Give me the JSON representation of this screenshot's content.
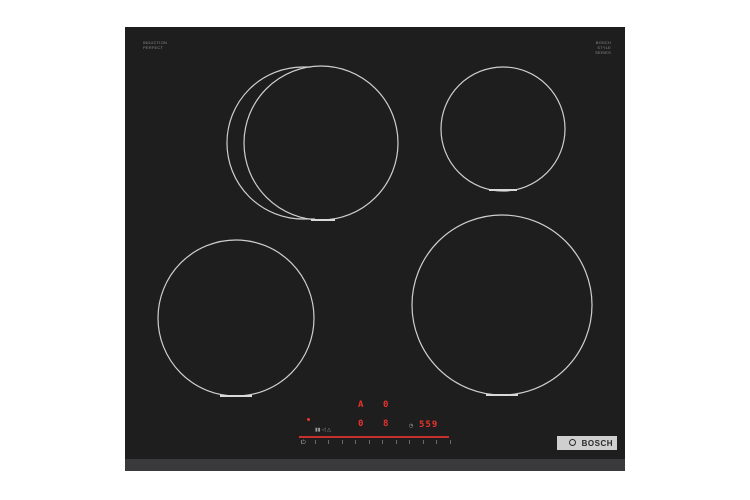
{
  "product": {
    "left_label": "INDUCTION\nPERFECT",
    "right_label": "BOSCH\nSTYLE\nSERIES",
    "brand": "BOSCH",
    "brand_icon": "bosch-logo-icon"
  },
  "displays": {
    "zone1": "A",
    "zone2": "0",
    "zone3": "0",
    "zone4": "8",
    "timer": "559"
  },
  "colors": {
    "glass": "#1e1e1f",
    "zone_outline": "#cfcfcf",
    "display_red": "#e8342c"
  }
}
